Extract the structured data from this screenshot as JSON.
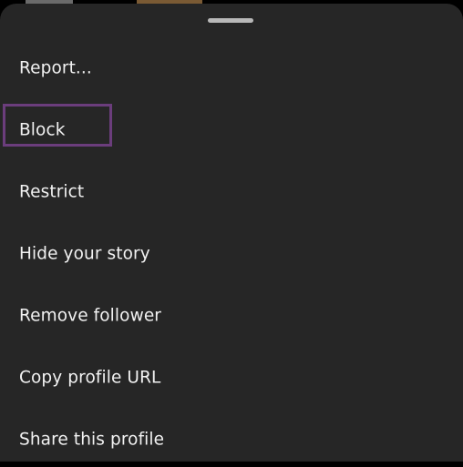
{
  "colors": {
    "sheet_background": "#262626",
    "text": "#f2f2f2",
    "highlight_border": "#6b3d7c",
    "handle": "#b8b8b8"
  },
  "menu": {
    "items": [
      {
        "id": "report",
        "label": "Report..."
      },
      {
        "id": "block",
        "label": "Block"
      },
      {
        "id": "restrict",
        "label": "Restrict"
      },
      {
        "id": "hide-story",
        "label": "Hide your story"
      },
      {
        "id": "remove-follower",
        "label": "Remove follower"
      },
      {
        "id": "copy-url",
        "label": "Copy profile URL"
      },
      {
        "id": "share-profile",
        "label": "Share this profile"
      }
    ],
    "highlighted_item": "block"
  }
}
